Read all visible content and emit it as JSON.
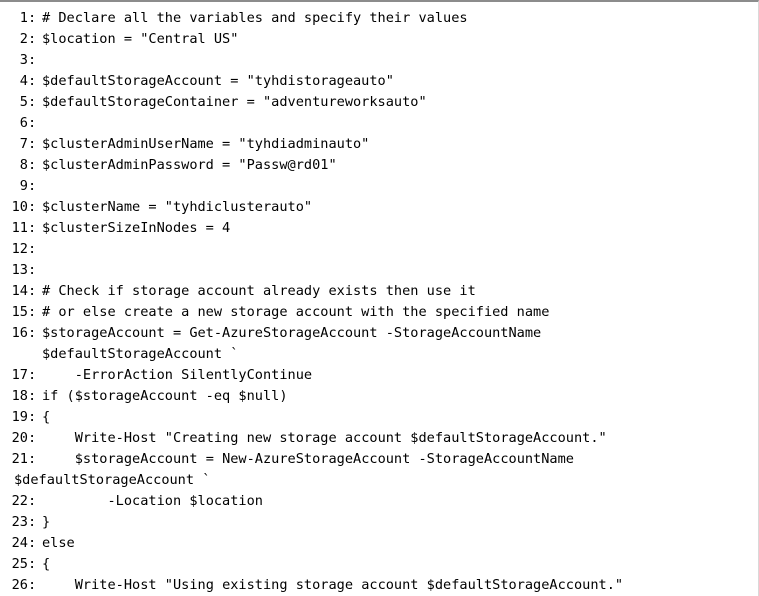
{
  "listing": {
    "language": "PowerShell",
    "first_line_number": 1,
    "last_line_number": 26,
    "colon_separator": ":",
    "lines": [
      {
        "n": " 1",
        "code": "# Declare all the variables and specify their values"
      },
      {
        "n": " 2",
        "code": "$location = \"Central US\""
      },
      {
        "n": " 3",
        "code": ""
      },
      {
        "n": " 4",
        "code": "$defaultStorageAccount = \"tyhdistorageauto\""
      },
      {
        "n": " 5",
        "code": "$defaultStorageContainer = \"adventureworksauto\""
      },
      {
        "n": " 6",
        "code": ""
      },
      {
        "n": " 7",
        "code": "$clusterAdminUserName = \"tyhdiadminauto\""
      },
      {
        "n": " 8",
        "code": "$clusterAdminPassword = \"Passw@rd01\""
      },
      {
        "n": " 9",
        "code": ""
      },
      {
        "n": "10",
        "code": "$clusterName = \"tyhdiclusterauto\""
      },
      {
        "n": "11",
        "code": "$clusterSizeInNodes = 4"
      },
      {
        "n": "12",
        "code": ""
      },
      {
        "n": "13",
        "code": ""
      },
      {
        "n": "14",
        "code": "# Check if storage account already exists then use it"
      },
      {
        "n": "15",
        "code": "# or else create a new storage account with the specified name"
      },
      {
        "n": "16",
        "code": "$storageAccount = Get-AzureStorageAccount -StorageAccountName",
        "cont": "$defaultStorageAccount `",
        "cont_align": "code"
      },
      {
        "n": "17",
        "code": "    -ErrorAction SilentlyContinue"
      },
      {
        "n": "18",
        "code": "if ($storageAccount -eq $null)"
      },
      {
        "n": "19",
        "code": "{"
      },
      {
        "n": "20",
        "code": "    Write-Host \"Creating new storage account $defaultStorageAccount.\""
      },
      {
        "n": "21",
        "code": "    $storageAccount = New-AzureStorageAccount -StorageAccountName",
        "cont": "$defaultStorageAccount `",
        "cont_align": "left"
      },
      {
        "n": "22",
        "code": "        -Location $location"
      },
      {
        "n": "23",
        "code": "}"
      },
      {
        "n": "24",
        "code": "else"
      },
      {
        "n": "25",
        "code": "{"
      },
      {
        "n": "26",
        "code": "    Write-Host \"Using existing storage account $defaultStorageAccount.\""
      }
    ]
  },
  "colors": {
    "page_background": "#ffffff",
    "text": "#000000",
    "top_rule": "#8c8c8c",
    "right_rule": "#d9d9d9"
  }
}
